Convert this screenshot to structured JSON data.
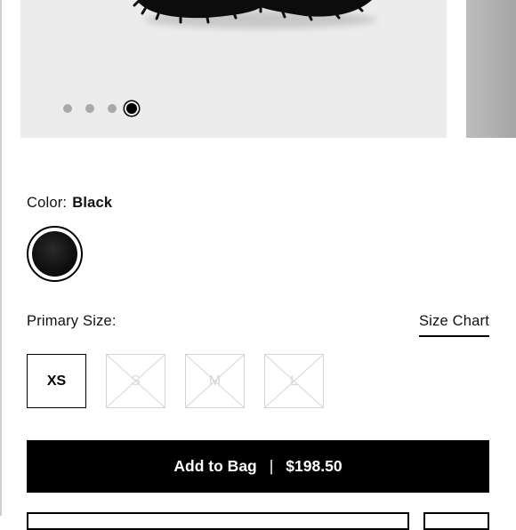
{
  "product": {
    "color_label": "Color:",
    "color_value": "Black",
    "swatch_color": "#111111"
  },
  "carousel": {
    "total_images": 4,
    "active_index": 4
  },
  "sizes": {
    "label": "Primary Size:",
    "chart_link": "Size Chart",
    "options": [
      {
        "label": "XS",
        "state": "selected"
      },
      {
        "label": "S",
        "state": "unavailable"
      },
      {
        "label": "M",
        "state": "unavailable"
      },
      {
        "label": "L",
        "state": "unavailable"
      }
    ]
  },
  "cta": {
    "label": "Add to Bag",
    "separator": "|",
    "price": "$198.50"
  }
}
